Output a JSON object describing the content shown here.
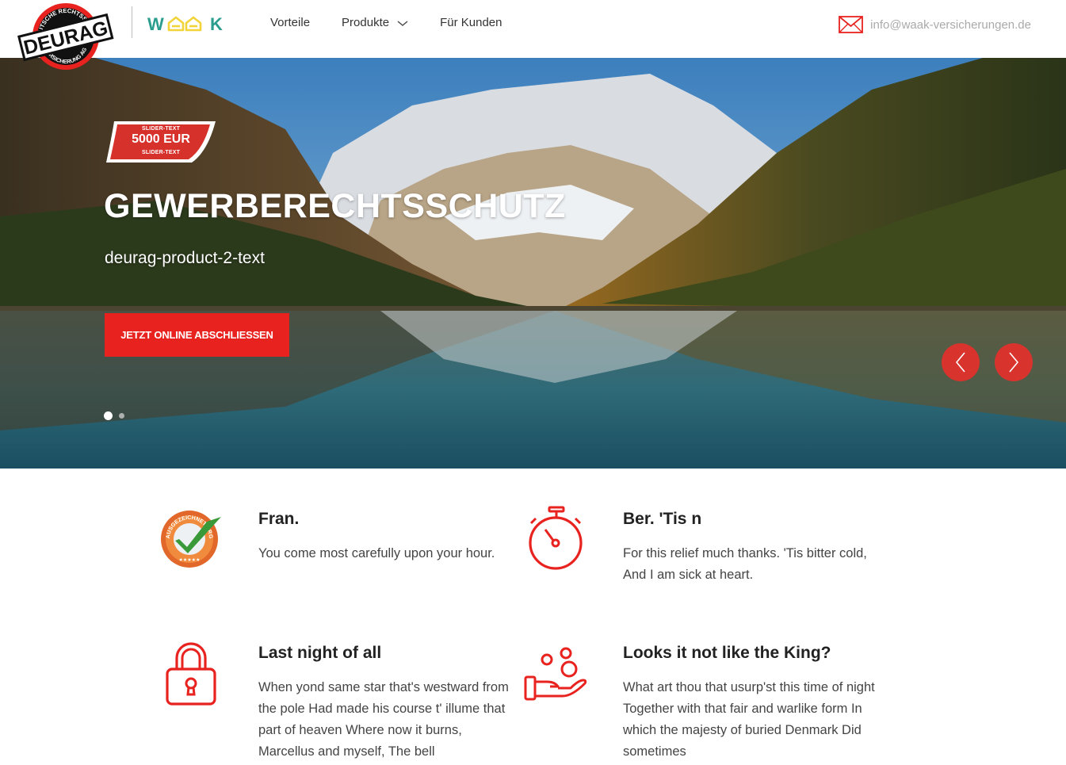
{
  "header": {
    "logo_deurag": {
      "word": "DEURAG",
      "ring_top": "DEUTSCHE RECHTSSCHUTZ",
      "ring_bottom": "VERSICHERUNG AG"
    },
    "logo_waak": {
      "letter_left": "W",
      "letter_right": "K"
    },
    "nav": [
      {
        "label": "Vorteile"
      },
      {
        "label": "Produkte",
        "has_dropdown": true
      },
      {
        "label": "Für Kunden"
      }
    ],
    "email": "info@waak-versicherungen.de"
  },
  "hero": {
    "badge": {
      "top": "SLIDER-TEXT",
      "main": "5000 EUR",
      "bottom": "SLIDER-TEXT"
    },
    "title": "GEWERBERECHTSSCHUTZ",
    "subtitle": "deurag-product-2-text",
    "cta": "JETZT ONLINE ABSCHLIESSEN",
    "slides_total": 2,
    "slide_active": 1
  },
  "features": [
    {
      "icon": "award-seal-icon",
      "seal_text": "AUSGEZEICHNET.ORG",
      "title": "Fran.",
      "text": "You come most carefully upon your hour."
    },
    {
      "icon": "stopwatch-icon",
      "title": "Ber. 'Tis n",
      "text": "For this relief much thanks. 'Tis bitter cold, And I am sick at heart."
    },
    {
      "icon": "padlock-icon",
      "title": "Last night of all",
      "text": "When yond same star that's westward from the pole Had made his course t' illume that part of heaven Where now it burns, Marcellus and myself, The bell"
    },
    {
      "icon": "hand-coins-icon",
      "title": "Looks it not like the King?",
      "text": "What art thou that usurp'st this time of night Together with that fair and warlike form In which the majesty of buried Denmark Did sometimes"
    }
  ],
  "colors": {
    "accent_red": "#e8231f",
    "arrow_red": "#d9332e",
    "waak_green": "#2a9d8f",
    "waak_yellow": "#f2d43a"
  }
}
